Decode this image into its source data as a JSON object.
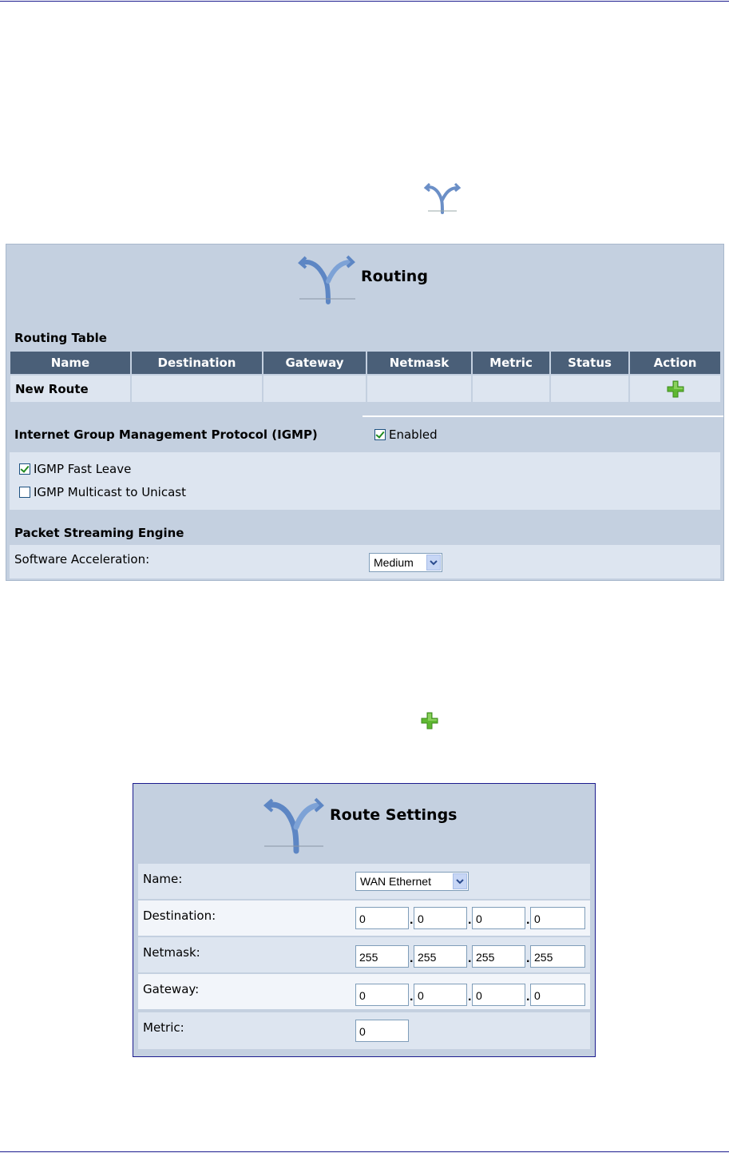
{
  "routing": {
    "title": "Routing",
    "routing_table_label": "Routing Table",
    "columns": [
      "Name",
      "Destination",
      "Gateway",
      "Netmask",
      "Metric",
      "Status",
      "Action"
    ],
    "rows": [
      {
        "name": "New Route",
        "destination": "",
        "gateway": "",
        "netmask": "",
        "metric": "",
        "status": "",
        "action": "add-icon"
      }
    ],
    "igmp": {
      "section_label": "Internet Group Management Protocol (IGMP)",
      "enabled_label": "Enabled",
      "enabled": true,
      "fast_leave_label": "IGMP Fast Leave",
      "fast_leave": true,
      "multicast_to_unicast_label": "IGMP Multicast to Unicast",
      "multicast_to_unicast": false
    },
    "pse": {
      "section_label": "Packet Streaming Engine",
      "software_acceleration_label": "Software Acceleration:",
      "software_acceleration_value": "Medium"
    }
  },
  "route_settings": {
    "title": "Route Settings",
    "name_label": "Name:",
    "name_value": "WAN Ethernet",
    "destination_label": "Destination:",
    "destination": [
      "0",
      "0",
      "0",
      "0"
    ],
    "netmask_label": "Netmask:",
    "netmask": [
      "255",
      "255",
      "255",
      "255"
    ],
    "gateway_label": "Gateway:",
    "gateway": [
      "0",
      "0",
      "0",
      "0"
    ],
    "metric_label": "Metric:",
    "metric": "0"
  },
  "colors": {
    "panel_bg": "#c4d0e0",
    "header_bg": "#4a5f78",
    "row_bg": "#dde5f0",
    "rule": "#1b1b8e",
    "add_icon": "#5fb832"
  }
}
